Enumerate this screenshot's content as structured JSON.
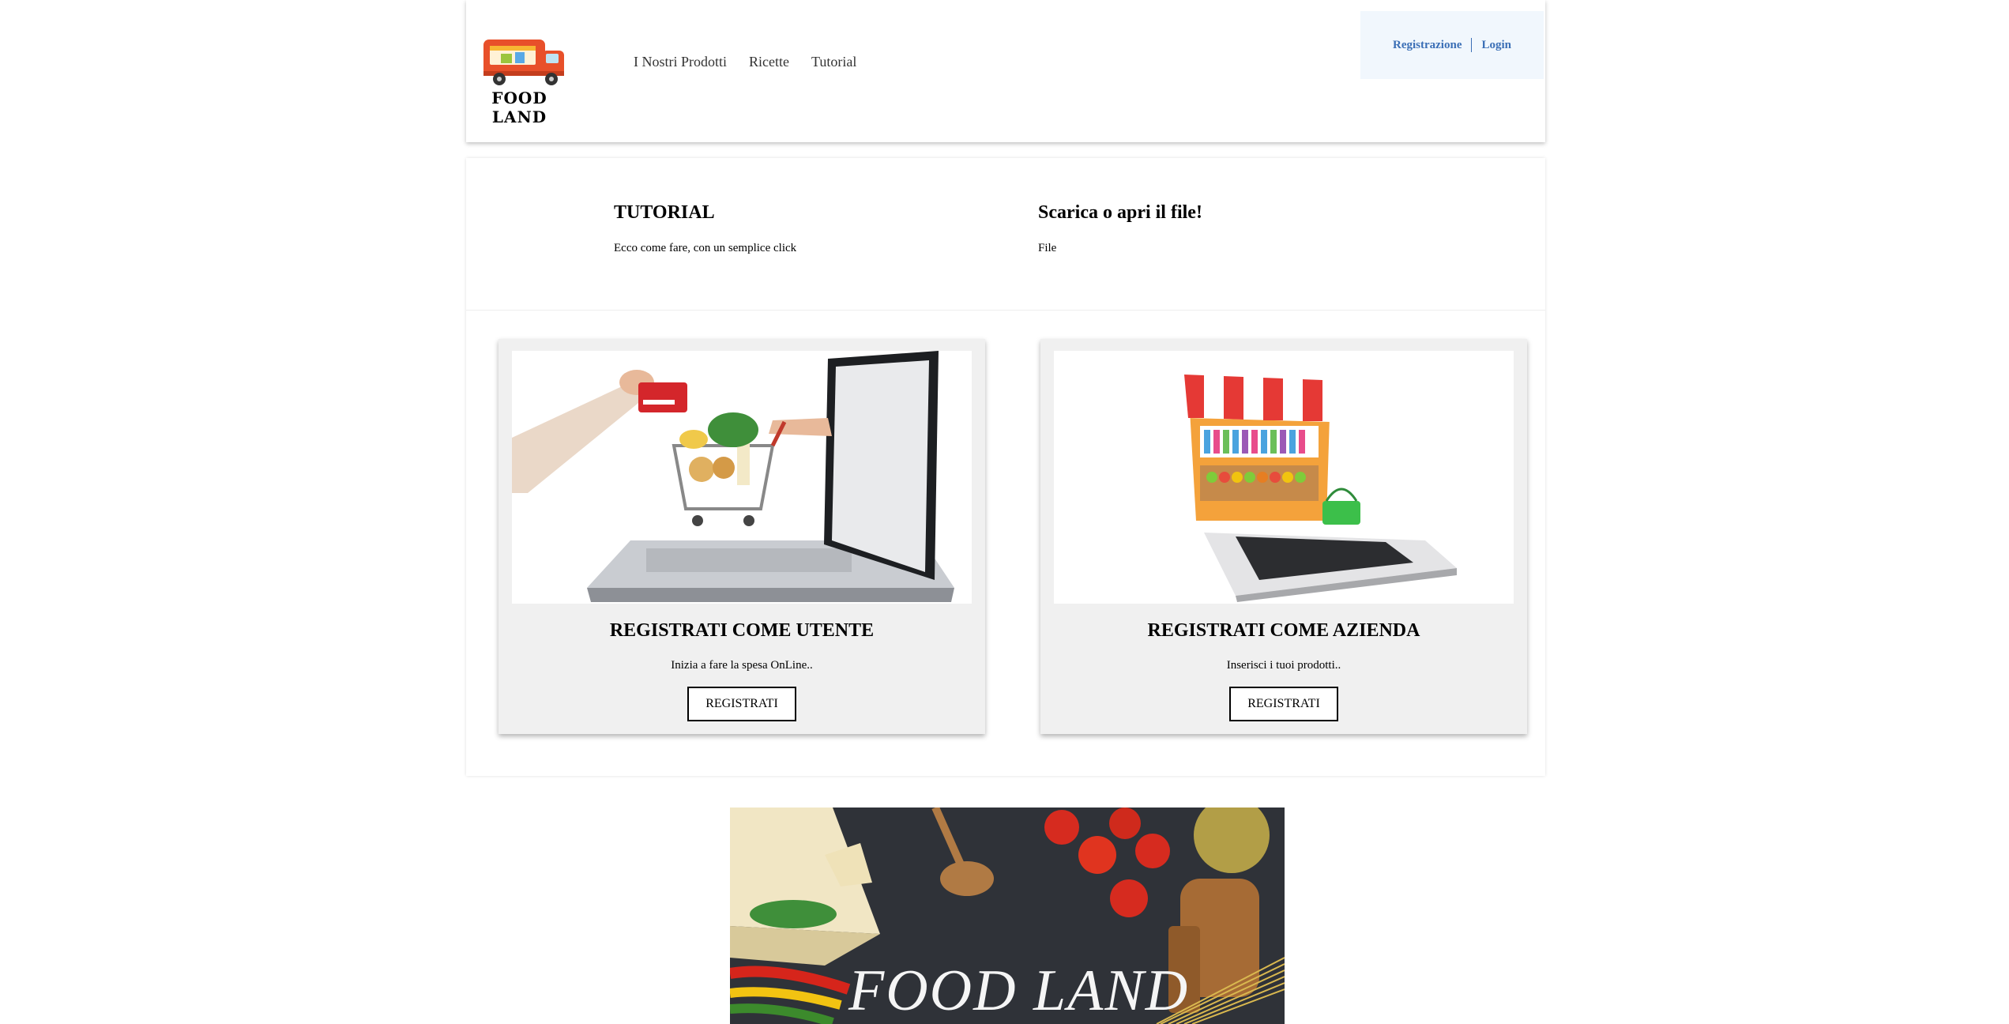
{
  "brand": {
    "name": "FOOD LAND"
  },
  "nav": {
    "items": [
      "I Nostri Prodotti",
      "Ricette",
      "Tutorial"
    ]
  },
  "auth": {
    "register": "Registrazione",
    "login": "Login"
  },
  "intro": {
    "left": {
      "title": "TUTORIAL",
      "text": "Ecco come fare, con un semplice click"
    },
    "right": {
      "title": "Scarica o apri il file!",
      "text": "File"
    }
  },
  "cards": [
    {
      "title": "REGISTRATI COME UTENTE",
      "subtitle": "Inizia a fare la spesa OnLine..",
      "button": "REGISTRATI"
    },
    {
      "title": "REGISTRATI COME AZIENDA",
      "subtitle": "Inserisci i tuoi prodotti..",
      "button": "REGISTRATI"
    }
  ],
  "banner": {
    "text": "FOOD LAND"
  },
  "colors": {
    "link": "#3b6fb6",
    "auth_bg": "#f1f7fd",
    "card_bg": "#f0f0f0",
    "truck": "#e8502a"
  }
}
